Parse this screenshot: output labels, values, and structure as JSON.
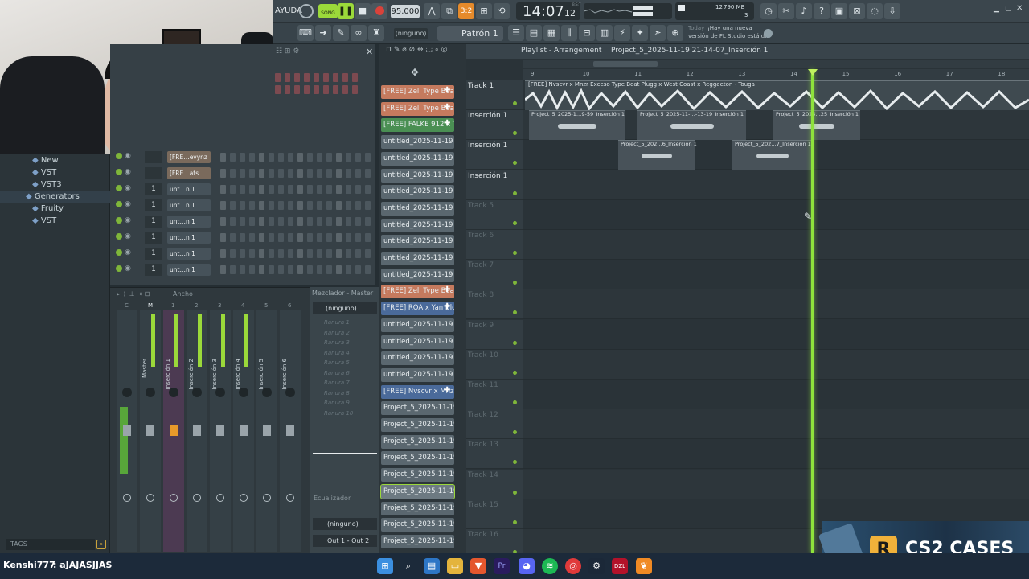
{
  "topbar": {
    "help_menu": "AYUDA",
    "song_label": "SONG",
    "tempo": "95.000",
    "snap_label": "3:2",
    "time_main": "14:07",
    "time_sub": "12",
    "time_small": "B:S:T",
    "cpu_value": "12",
    "mem_value": "790 MB",
    "poly_value": "3"
  },
  "toolbar2": {
    "preset_none": "(ninguno)",
    "pattern_label": "Patrón 1",
    "news_day": "Today",
    "news_text_1": "¡Hay una nueva",
    "news_text_2": "versión de FL Studio está d…"
  },
  "browser": {
    "items": [
      {
        "label": "New",
        "indent": 2
      },
      {
        "label": "VST",
        "indent": 2
      },
      {
        "label": "VST3",
        "indent": 2
      },
      {
        "label": "Generators",
        "indent": 1
      },
      {
        "label": "Fruity",
        "indent": 2
      },
      {
        "label": "VST",
        "indent": 2
      }
    ],
    "tags_label": "TAGS"
  },
  "rack": {
    "channels": [
      {
        "num": "",
        "name": "[FRE…evynz"
      },
      {
        "num": "",
        "name": "[FRE…ats"
      },
      {
        "num": "1",
        "name": "unt…n 1"
      },
      {
        "num": "1",
        "name": "unt…n 1"
      },
      {
        "num": "1",
        "name": "unt…n 1"
      },
      {
        "num": "1",
        "name": "unt…n 1"
      },
      {
        "num": "1",
        "name": "unt…n 1"
      },
      {
        "num": "1",
        "name": "unt…n 1"
      }
    ]
  },
  "mixer": {
    "width_label": "Ancho",
    "title": "Mezclador - Master",
    "tracks": [
      "Master",
      "Inserción 1",
      "Inserción 2",
      "Inserción 3",
      "Inserción 4",
      "Inserción 5",
      "Inserción 6"
    ],
    "track_nums": [
      "C",
      "M",
      "1",
      "2",
      "3",
      "4",
      "5",
      "6"
    ],
    "side_preset": "(ninguno)",
    "slots": [
      "Ranura 1",
      "Ranura 2",
      "Ranura 3",
      "Ranura 4",
      "Ranura 5",
      "Ranura 6",
      "Ranura 7",
      "Ranura 8",
      "Ranura 9",
      "Ranura 10"
    ],
    "eq_label": "Ecualizador",
    "out_preset": "(ninguno)",
    "out_label": "Out 1 - Out 2"
  },
  "patterns": [
    {
      "label": "[FREE] Zell Type Beat…",
      "kind": "audio"
    },
    {
      "label": "[FREE] Zell Type Beat…",
      "kind": "audio"
    },
    {
      "label": "[FREE] FALKE 912 x T…",
      "kind": "audio-green"
    },
    {
      "label": "untitled_2025-11-19 16-…",
      "kind": "pattern"
    },
    {
      "label": "untitled_2025-11-19 16-…",
      "kind": "pattern"
    },
    {
      "label": "untitled_2025-11-19 16-…",
      "kind": "pattern"
    },
    {
      "label": "untitled_2025-11-19 16-…",
      "kind": "pattern"
    },
    {
      "label": "untitled_2025-11-19 16-…",
      "kind": "pattern"
    },
    {
      "label": "untitled_2025-11-19 16-…",
      "kind": "pattern"
    },
    {
      "label": "untitled_2025-11-19 16-…",
      "kind": "pattern"
    },
    {
      "label": "untitled_2025-11-19 16-…",
      "kind": "pattern"
    },
    {
      "label": "untitled_2025-11-19 16-…",
      "kind": "pattern"
    },
    {
      "label": "[FREE] Zell Type Beat…",
      "kind": "audio"
    },
    {
      "label": "[FREE] ROA x Yan Blo…",
      "kind": "audio-blue"
    },
    {
      "label": "untitled_2025-11-19 16-…",
      "kind": "pattern"
    },
    {
      "label": "untitled_2025-11-19 16-…",
      "kind": "pattern"
    },
    {
      "label": "untitled_2025-11-19 16-…",
      "kind": "pattern"
    },
    {
      "label": "untitled_2025-11-19 16-…",
      "kind": "pattern"
    },
    {
      "label": "[FREE] Nvscvr x Mnzr…",
      "kind": "audio-blue"
    },
    {
      "label": "Project_5_2025-11-19 2…",
      "kind": "pattern"
    },
    {
      "label": "Project_5_2025-11-19 2…",
      "kind": "pattern"
    },
    {
      "label": "Project_5_2025-11-19 2…",
      "kind": "pattern"
    },
    {
      "label": "Project_5_2025-11-19 2…",
      "kind": "pattern"
    },
    {
      "label": "Project_5_2025-11-19 2…",
      "kind": "pattern"
    },
    {
      "label": "Project_5_2025-11-19 2…",
      "kind": "selected"
    },
    {
      "label": "Project_5_2025-11-19 2…",
      "kind": "pattern"
    },
    {
      "label": "Project_5_2025-11-19 2…",
      "kind": "pattern"
    },
    {
      "label": "Project_5_2025-11-19 2…",
      "kind": "pattern"
    }
  ],
  "playlist": {
    "title": "Playlist - Arrangement",
    "project": "Project_5_2025-11-19 21-14-07_Inserción 1",
    "ruler": [
      "9",
      "10",
      "11",
      "12",
      "13",
      "14",
      "15",
      "16",
      "17",
      "18"
    ],
    "tracks": [
      "Track 1",
      "Inserción 1",
      "Inserción 1",
      "Inserción 1",
      "Track 5",
      "Track 6",
      "Track 7",
      "Track 8",
      "Track 9",
      "Track 10",
      "Track 11",
      "Track 12",
      "Track 13",
      "Track 14",
      "Track 15",
      "Track 16"
    ],
    "audio_clip": "[FREE] Nvscvr x Mnzr Exceso Type Beat  Plugg x West Coast x Reggaeton - Touga",
    "clips": [
      {
        "label": "Project_5_2025-1…9-59_Inserción 1",
        "row": 1
      },
      {
        "label": "Project_5_2025-11-…-13-19_Inserción 1",
        "row": 1
      },
      {
        "label": "Project_5_2025…25_Inserción 1",
        "row": 1
      },
      {
        "label": "Project_5_202…6_Inserción 1",
        "row": 2
      },
      {
        "label": "Project_5_202…7_Inserción 1",
        "row": 2
      }
    ]
  },
  "stream": {
    "chat_user": "Kenshi777",
    "chat_msg": ": aJAJASJJAS",
    "sponsor": "CS2 CASES",
    "sponsor_logo": "R"
  },
  "colors": {
    "accent_green": "#9bd93a",
    "record_red": "#d9423a",
    "audio_clip": "#d9886a",
    "pattern_clip": "#6f7c84"
  }
}
